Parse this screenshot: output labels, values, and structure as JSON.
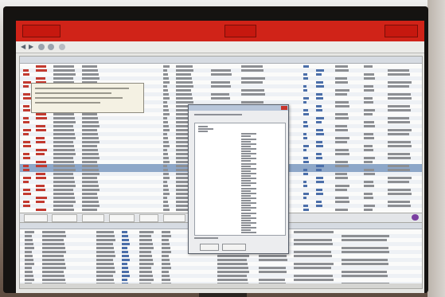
{
  "window": {
    "titlebar_color": "#d02318"
  },
  "icons": [
    "back-arrow-icon",
    "forward-arrow-icon",
    "refresh-icon",
    "settings-icon",
    "close-icon"
  ],
  "colors": {
    "screen_background": "#e6e6e3",
    "selection_row": "#8ea7c8",
    "dialog_title": "#b8c6da"
  }
}
